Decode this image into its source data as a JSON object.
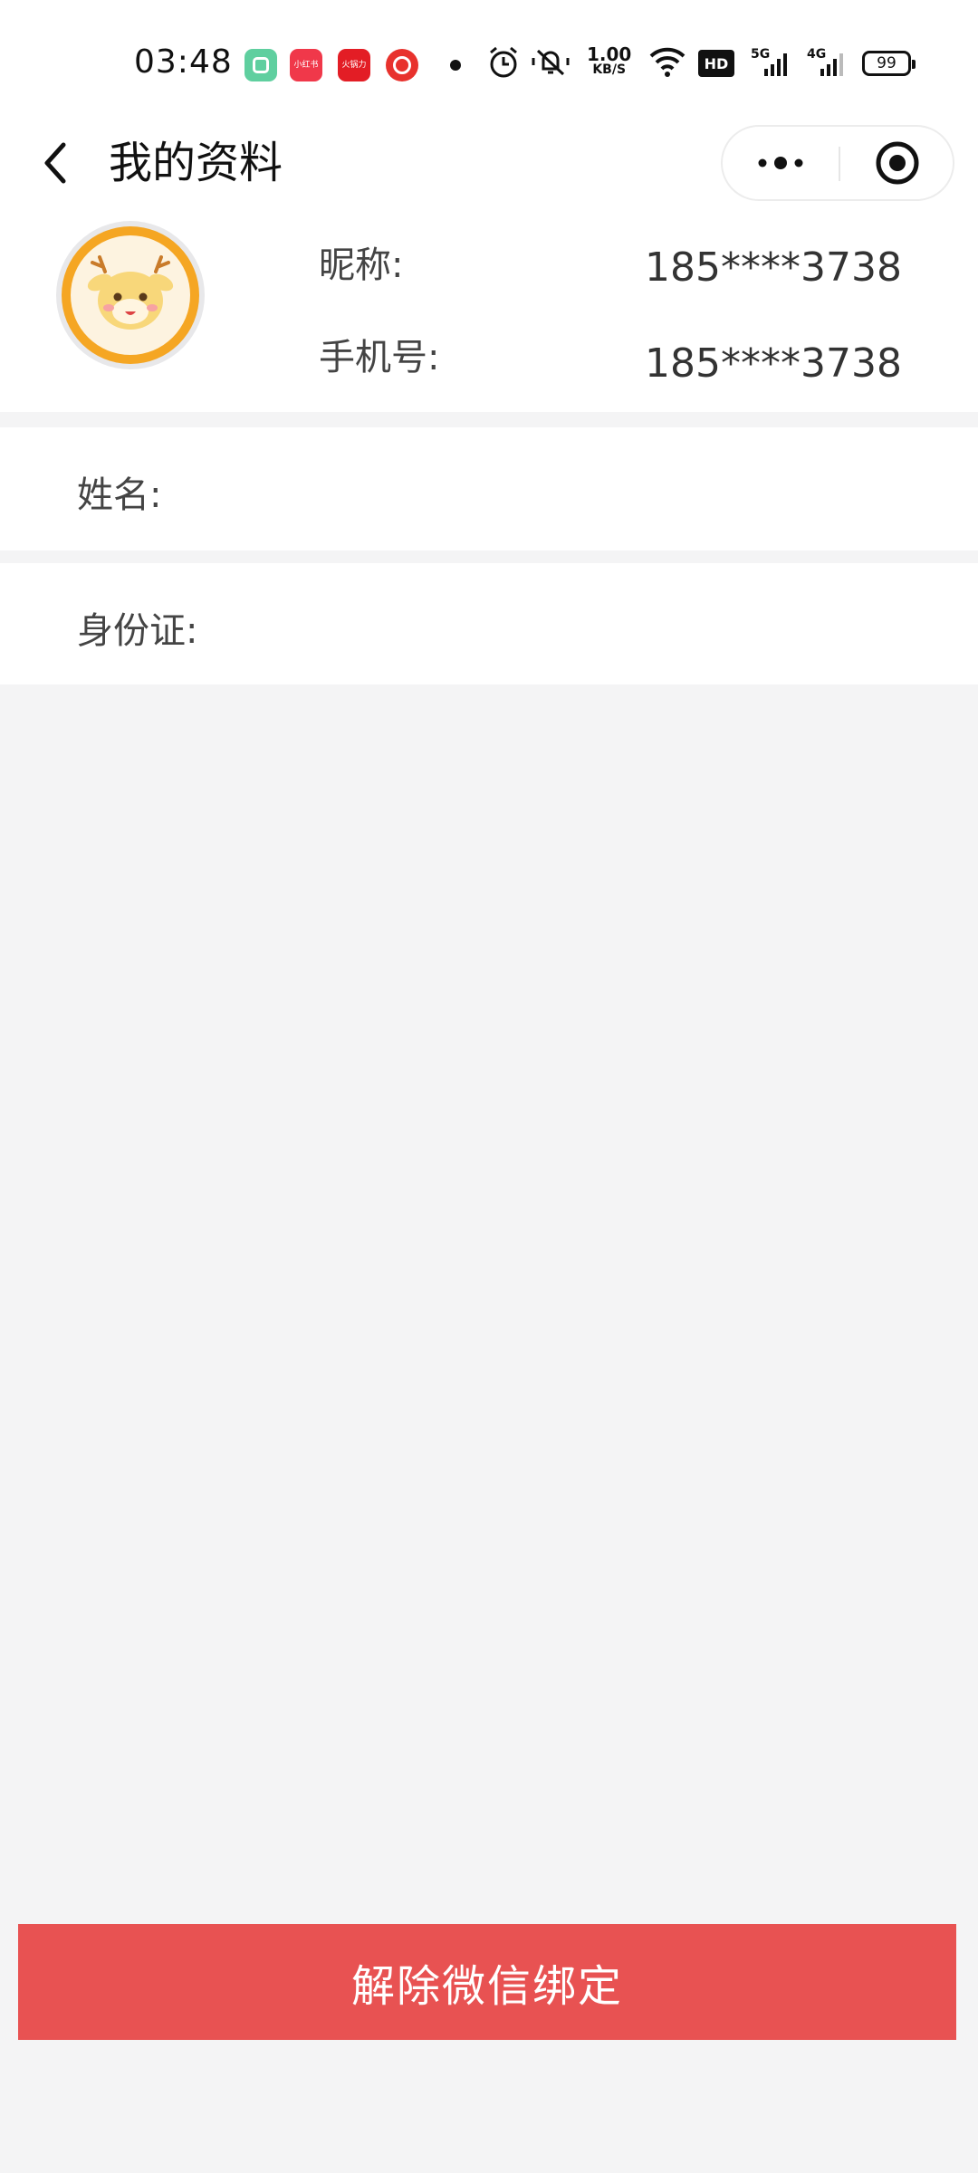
{
  "status_bar": {
    "time": "03:48",
    "apps": [
      {
        "name": "app-icon-green",
        "label": ""
      },
      {
        "name": "xiaohongshu",
        "label": "小红书"
      },
      {
        "name": "app-red",
        "label": "火锅力"
      },
      {
        "name": "netease-music",
        "label": ""
      }
    ],
    "net_speed_value": "1.00",
    "net_speed_unit": "KB/S",
    "hd_badge": "HD",
    "network_5g": "5G",
    "network_4g": "4G",
    "battery": "99"
  },
  "nav": {
    "title": "我的资料",
    "icons": {
      "back": "chevron-left-icon",
      "more": "more-dots-icon",
      "close": "target-close-icon"
    }
  },
  "profile": {
    "nickname_label": "昵称:",
    "nickname_value": "185****3738",
    "phone_label": "手机号:",
    "phone_value": "185****3738"
  },
  "form": {
    "name_label": "姓名:",
    "name_value": "",
    "id_label": "身份证:",
    "id_value": ""
  },
  "actions": {
    "unbind_label": "解除微信绑定",
    "unbind_color": "#e85252"
  }
}
